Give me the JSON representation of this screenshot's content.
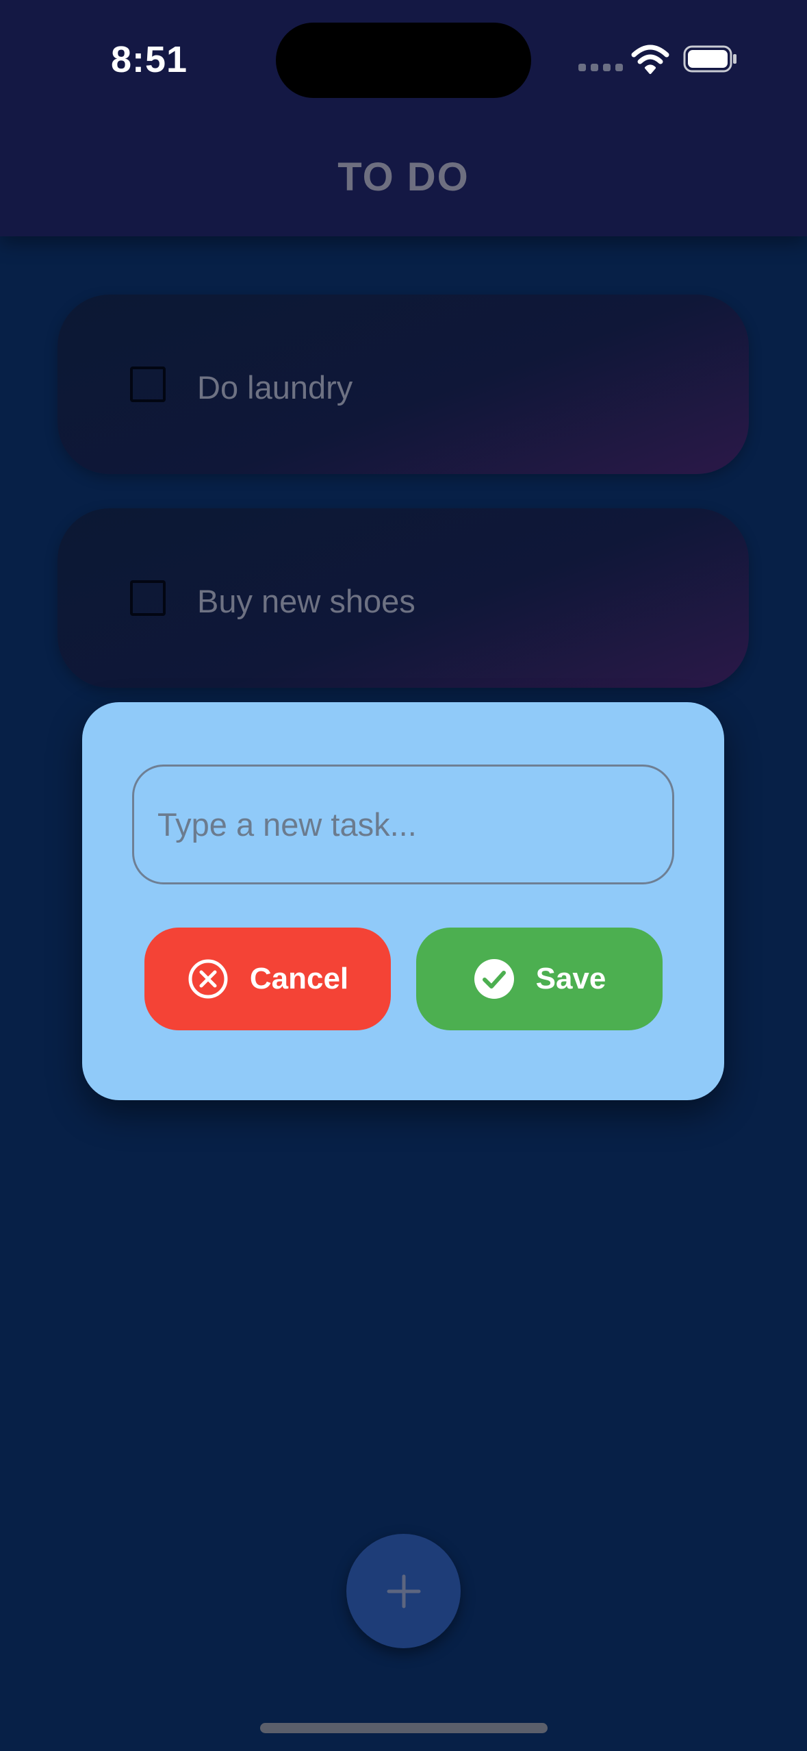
{
  "status_bar": {
    "time": "8:51"
  },
  "app": {
    "title": "TO DO"
  },
  "tasks": [
    {
      "label": "Do laundry",
      "checked": false
    },
    {
      "label": "Buy new shoes",
      "checked": false
    }
  ],
  "dialog": {
    "input_value": "",
    "input_placeholder": "Type a new task...",
    "cancel_label": "Cancel",
    "save_label": "Save"
  },
  "icons": {
    "cancel": "circle-x-icon",
    "save": "circle-check-icon",
    "fab": "plus-icon"
  },
  "colors": {
    "background": "#072047",
    "app_bar": "#141844",
    "dialog": "#90caf9",
    "cancel": "#f44336",
    "save": "#4caf50",
    "fab": "#1e3d78"
  }
}
